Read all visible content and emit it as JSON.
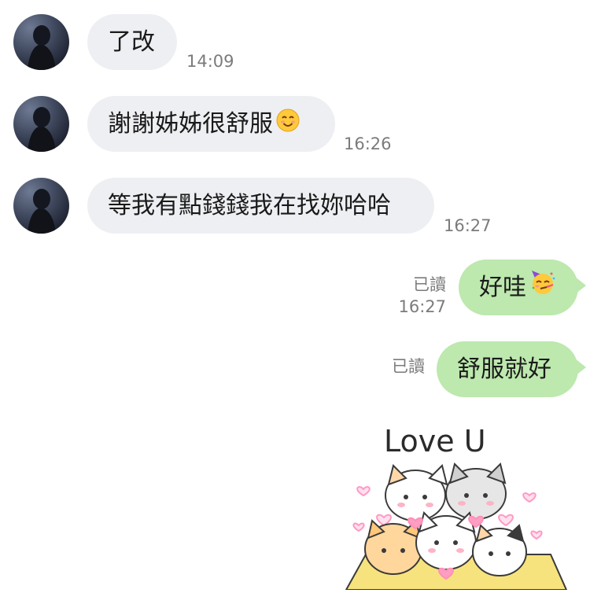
{
  "messages": [
    {
      "side": "in",
      "text": "了改",
      "time": "14:09"
    },
    {
      "side": "in",
      "text": "謝謝姊姊很舒服",
      "emoji": "smiling-face-icon",
      "time": "16:26"
    },
    {
      "side": "in",
      "text": "等我有點錢錢我在找妳哈哈",
      "time": "16:27"
    },
    {
      "side": "out",
      "text": "好哇",
      "emoji": "partying-face-icon",
      "read": "已讀",
      "time": "16:27"
    },
    {
      "side": "out",
      "text": "舒服就好",
      "read": "已讀"
    }
  ],
  "sticker": {
    "text": "Love U",
    "icon": "cats-love-sticker"
  },
  "colors": {
    "incoming_bubble": "#eeeff2",
    "outgoing_bubble": "#bde8ae",
    "meta": "#7b7b7b"
  }
}
